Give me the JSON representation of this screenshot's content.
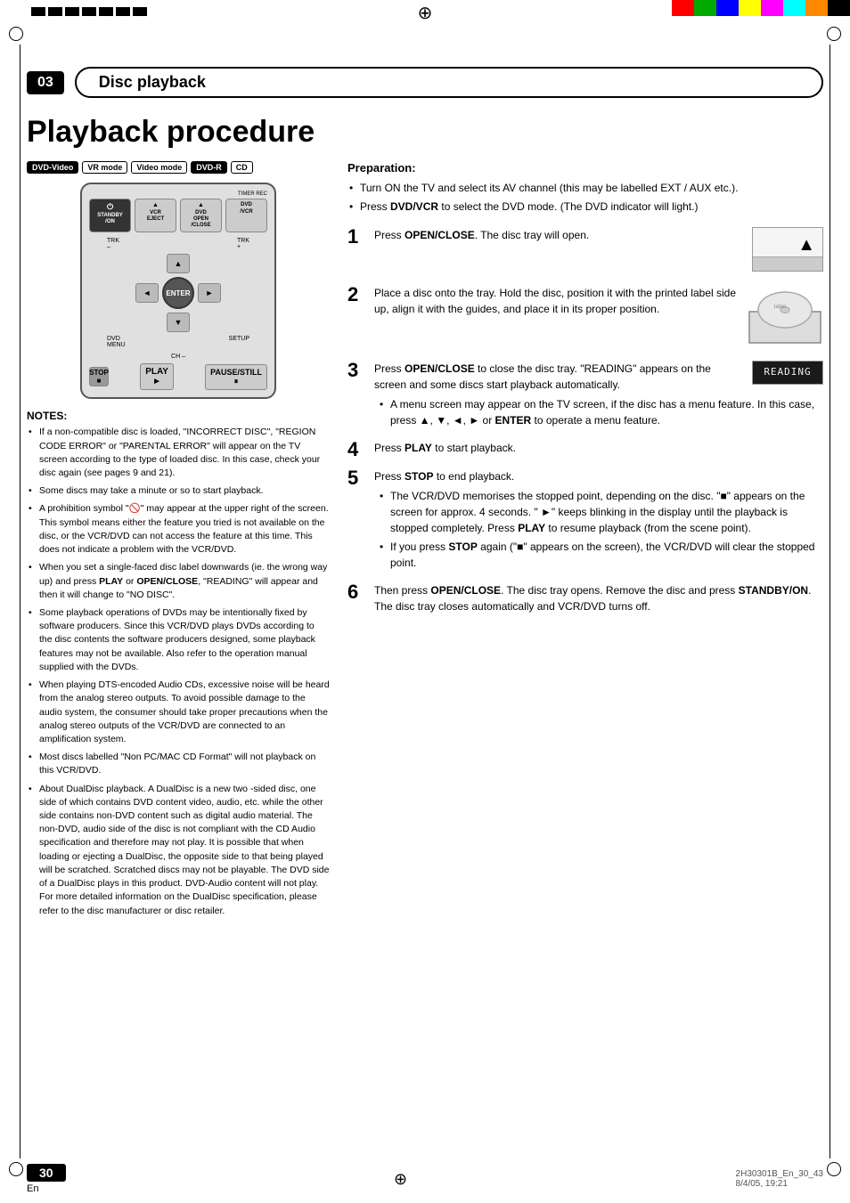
{
  "page": {
    "chapter_number": "03",
    "chapter_title": "Disc playback",
    "page_title": "Playback procedure",
    "page_number": "30",
    "page_lang": "En",
    "footer_file": "2H30301B_En_30_43",
    "footer_page": "30",
    "footer_date": "8/4/05, 19:21"
  },
  "badges": [
    {
      "label": "DVD-Video",
      "style": "filled"
    },
    {
      "label": "VR mode",
      "style": "outline"
    },
    {
      "label": "Video mode",
      "style": "outline"
    },
    {
      "label": "DVD-R",
      "style": "filled"
    },
    {
      "label": "CD",
      "style": "outline"
    }
  ],
  "preparation": {
    "title": "Preparation:",
    "items": [
      "Turn ON the TV and select its AV channel (this may be labelled EXT / AUX etc.).",
      "Press DVD/VCR to select the DVD mode. (The DVD indicator will light.)"
    ]
  },
  "steps": [
    {
      "number": "1",
      "text": "Press OPEN/CLOSE. The disc tray will open."
    },
    {
      "number": "2",
      "text": "Place a disc onto the tray. Hold the disc, position it with the printed label side up, align it with the guides, and place it in its proper position."
    },
    {
      "number": "3",
      "text": "Press OPEN/CLOSE to close the disc tray. \"READING\" appears on the screen and some discs start playback automatically.",
      "sub": [
        "A menu screen may appear on the TV screen, if the disc has a menu feature. In this case, press ▲, ▼, ◄, ► or ENTER to operate a menu feature."
      ]
    },
    {
      "number": "4",
      "text": "Press PLAY to start playback."
    },
    {
      "number": "5",
      "text": "Press STOP to end playback.",
      "sub": [
        "The VCR/DVD memorises the stopped point, depending on the disc. \"■\" appears on the screen for approx. 4 seconds. \" ►\" keeps blinking in the display until the playback is stopped completely. Press PLAY to resume playback (from the scene point).",
        "If you press STOP again (\"■\" appears on the screen), the VCR/DVD will clear the stopped point."
      ]
    },
    {
      "number": "6",
      "text": "Then press OPEN/CLOSE. The disc tray opens. Remove the disc and press STANDBY/ON. The disc tray closes automatically and VCR/DVD turns off."
    }
  ],
  "notes": {
    "title": "NOTES:",
    "items": [
      "If a non-compatible disc is loaded, \"INCORRECT DISC\", \"REGION CODE ERROR\" or \"PARENTAL ERROR\" will appear on the TV screen according to the type of loaded disc. In this case, check your disc again (see pages 9 and 21).",
      "Some discs may take a minute or so to start playback.",
      "A prohibition symbol \"🚫\" may appear at the upper right of the screen. This symbol means either the feature you tried is not available on the disc, or the VCR/DVD can not access the feature at this time. This does not indicate a problem with the VCR/DVD.",
      "When you set a single-faced disc label downwards (ie. the wrong way up) and press PLAY or OPEN/CLOSE, \"READING\" will appear and then it will change to \"NO DISC\".",
      "Some playback operations of DVDs may be intentionally fixed by software producers. Since this VCR/DVD plays DVDs according to the disc contents the software producers designed, some playback features may not be available. Also refer to the operation manual supplied with the DVDs.",
      "When playing DTS-encoded Audio CDs, excessive noise will be heard from the analog stereo outputs. To avoid possible damage to the audio system, the consumer should take proper precautions when the analog stereo outputs of the VCR/DVD are connected to an amplification system.",
      "Most discs labelled \"Non PC/MAC CD Format\" will not playback on this VCR/DVD.",
      "About DualDisc playback. A DualDisc is a new two -sided disc, one side of which contains DVD content video, audio, etc. while the other side contains non-DVD content such as digital audio material. The non-DVD, audio side of the disc is not compliant with the CD Audio specification and therefore may not play. It is possible that when loading or ejecting a DualDisc, the opposite side to that being played will be scratched. Scratched discs may not be playable. The DVD side of a DualDisc plays in this product. DVD-Audio content will not play. For more detailed information on the DualDisc specification, please refer to the disc manufacturer or disc retailer."
    ]
  },
  "remote": {
    "buttons": {
      "standby": "STANDBY\n/ON",
      "vcr_eject": "VCR\nEJECT",
      "dvd_open": "DVD\nOPEN\n/CLOSE",
      "dvd_vcr": "DVD\n/VCR",
      "enter": "ENTER",
      "dvd_menu": "DVD\nMENU",
      "setup": "SETUP",
      "trk_minus": "TRK\n–",
      "trk_plus": "TRK\n+",
      "stop": "STOP",
      "play": "PLAY",
      "pause": "PAUSE/STILL",
      "timer_rec": "TIMER REC",
      "ch_minus": "CH –"
    }
  },
  "colors": {
    "color_bar": [
      "#ff0000",
      "#00aa00",
      "#0000ff",
      "#ffff00",
      "#ff00ff",
      "#00ffff",
      "#ff8800",
      "#000000"
    ]
  },
  "reading_display": "READING"
}
